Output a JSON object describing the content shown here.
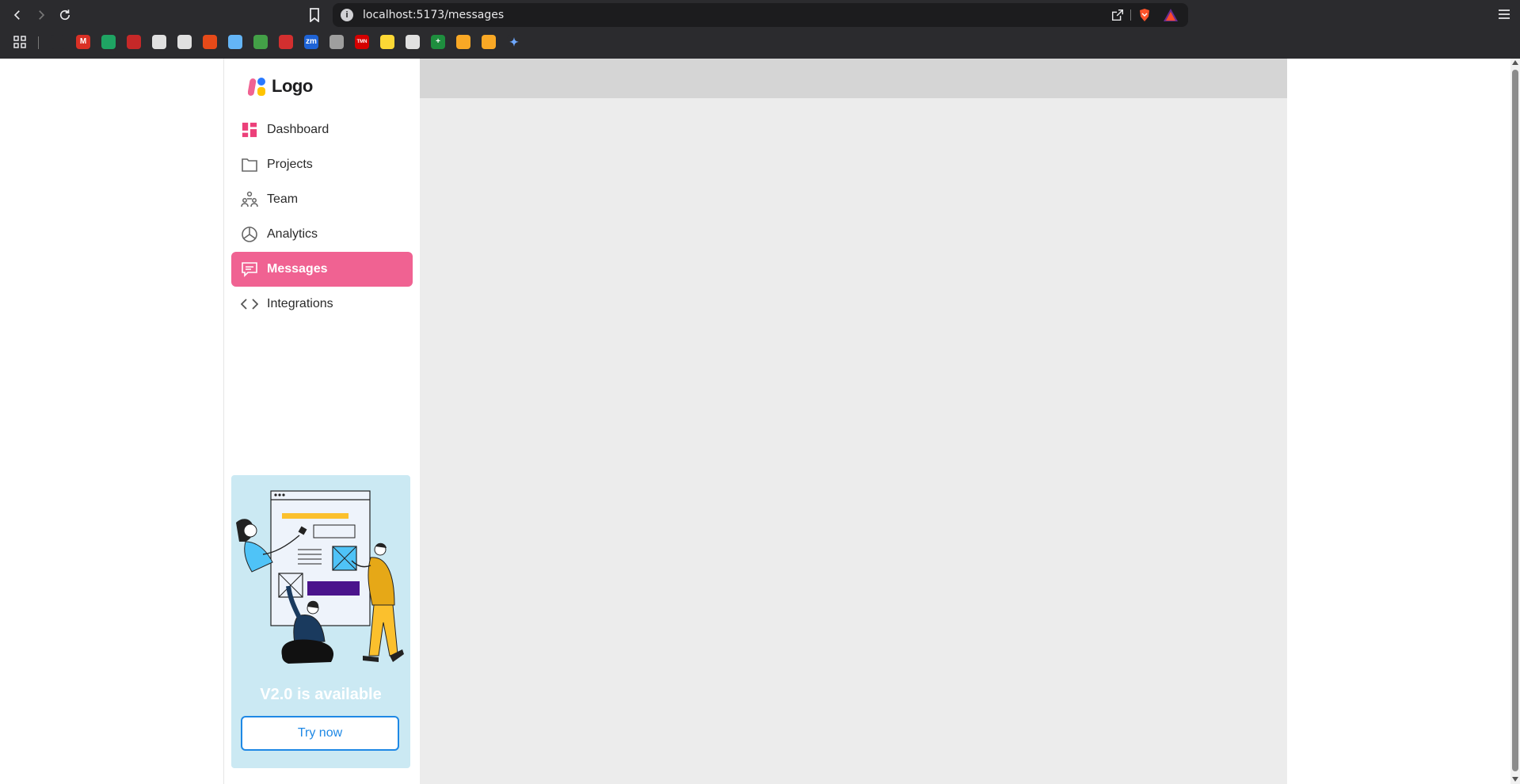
{
  "browser": {
    "url": "localhost:5173/messages",
    "bookmarks": [
      {
        "name": "apps-icon",
        "glyph": "",
        "color": "#2b2b2e"
      },
      {
        "name": "apple-icon",
        "glyph": "",
        "color": "#2b2b2e"
      },
      {
        "name": "gmail-icon",
        "glyph": "M",
        "color": "#d93025"
      },
      {
        "name": "drive-icon",
        "glyph": "",
        "color": "#1fa463"
      },
      {
        "name": "bookmark-red-icon",
        "glyph": "",
        "color": "#c62828"
      },
      {
        "name": "bookmark-doc-icon",
        "glyph": "",
        "color": "#e0e0e0"
      },
      {
        "name": "bookmark-target-icon",
        "glyph": "",
        "color": "#e0e0e0"
      },
      {
        "name": "bookmark-bag-icon",
        "glyph": "",
        "color": "#e64a19"
      },
      {
        "name": "bookmark-image-icon",
        "glyph": "",
        "color": "#64b5f6"
      },
      {
        "name": "bookmark-bird-icon",
        "glyph": "",
        "color": "#43a047"
      },
      {
        "name": "bookmark-cat-icon",
        "glyph": "",
        "color": "#d32f2f"
      },
      {
        "name": "zoom-icon",
        "glyph": "zm",
        "color": "#1e63d6"
      },
      {
        "name": "bookmark-shield-icon",
        "glyph": "",
        "color": "#9e9e9e"
      },
      {
        "name": "tmn-icon",
        "glyph": "TMN",
        "color": "#d50000"
      },
      {
        "name": "bookmark-face-icon",
        "glyph": "",
        "color": "#fdd835"
      },
      {
        "name": "github-icon",
        "glyph": "",
        "color": "#e0e0e0"
      },
      {
        "name": "sheets-icon",
        "glyph": "+",
        "color": "#1e8e3e"
      },
      {
        "name": "bookmark-play-icon",
        "glyph": "",
        "color": "#f9a825"
      },
      {
        "name": "bookmark-play2-icon",
        "glyph": "",
        "color": "#f9a825"
      },
      {
        "name": "gemini-icon",
        "glyph": "✦",
        "color": "#2b2b2e"
      }
    ]
  },
  "logo": {
    "text": "Logo"
  },
  "nav": {
    "items": [
      {
        "label": "Dashboard",
        "icon": "dashboard-icon",
        "active": false
      },
      {
        "label": "Projects",
        "icon": "folder-icon",
        "active": false
      },
      {
        "label": "Team",
        "icon": "team-icon",
        "active": false
      },
      {
        "label": "Analytics",
        "icon": "pie-chart-icon",
        "active": false
      },
      {
        "label": "Messages",
        "icon": "message-icon",
        "active": true
      },
      {
        "label": "Integrations",
        "icon": "code-icon",
        "active": false
      }
    ]
  },
  "promo": {
    "title": "V2.0 is available",
    "button_label": "Try now"
  },
  "colors": {
    "accent": "#f06292",
    "promo_bg": "#cbe9f3",
    "button_blue": "#1e88e5"
  }
}
